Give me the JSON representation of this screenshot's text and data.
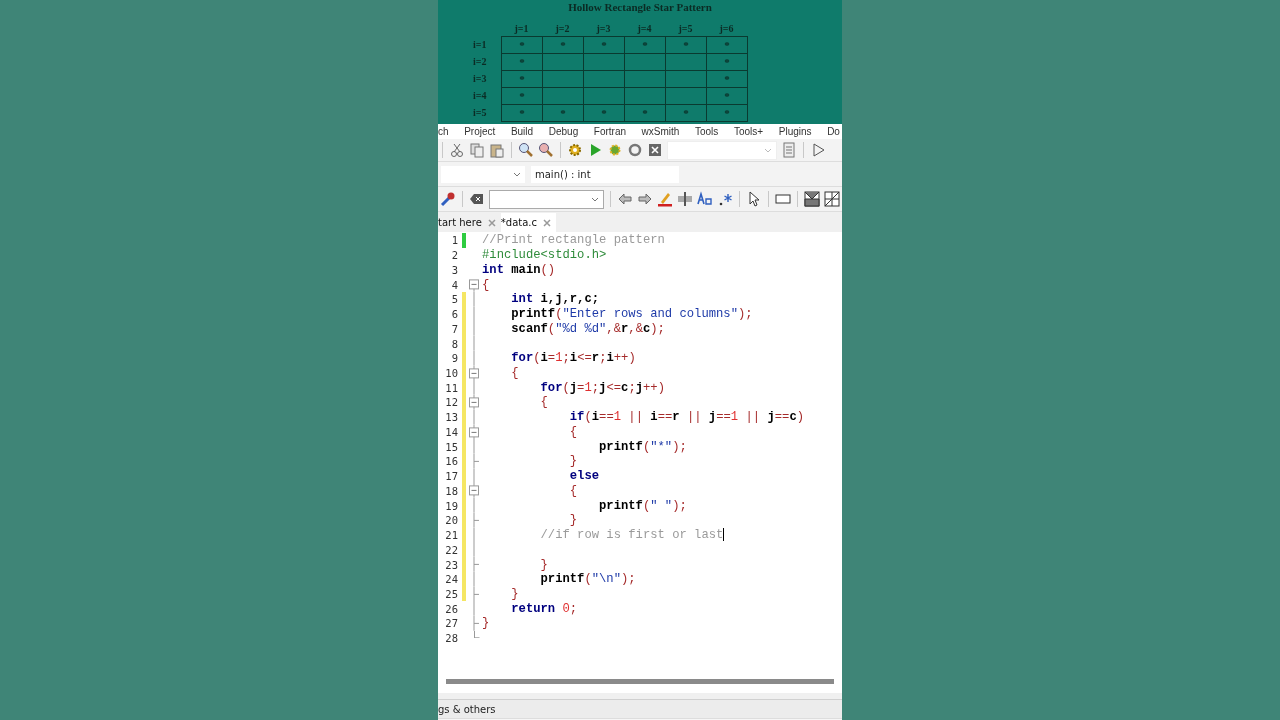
{
  "diagram": {
    "title": "Hollow Rectangle Star Pattern",
    "columns": [
      "j=1",
      "j=2",
      "j=3",
      "j=4",
      "j=5",
      "j=6"
    ],
    "rows": [
      {
        "label": "i=1",
        "cells": [
          "*",
          "*",
          "*",
          "*",
          "*",
          "*"
        ]
      },
      {
        "label": "i=2",
        "cells": [
          "*",
          null,
          null,
          null,
          null,
          "*"
        ]
      },
      {
        "label": "i=3",
        "cells": [
          "*",
          null,
          null,
          null,
          null,
          "*"
        ]
      },
      {
        "label": "i=4",
        "cells": [
          "*",
          null,
          null,
          null,
          null,
          "*"
        ]
      },
      {
        "label": "i=5",
        "cells": [
          "*",
          "*",
          "*",
          "*",
          "*",
          "*"
        ]
      }
    ]
  },
  "menu": [
    "ch",
    "Project",
    "Build",
    "Debug",
    "Fortran",
    "wxSmith",
    "Tools",
    "Tools+",
    "Plugins",
    "Do"
  ],
  "function_selector": {
    "value": "main() : int"
  },
  "tabs": [
    {
      "label": "tart here",
      "selected": false
    },
    {
      "label": "*data.c",
      "selected": true
    }
  ],
  "code_lines": [
    {
      "number": "1",
      "saved": true,
      "changed": false,
      "fold_start": false,
      "fold_end": false,
      "tokens": [
        {
          "kind": "comment",
          "text": "//Print rectangle pattern"
        }
      ]
    },
    {
      "number": "2",
      "saved": false,
      "changed": false,
      "fold_start": false,
      "fold_end": false,
      "tokens": [
        {
          "kind": "preprocessor",
          "text": "#include<stdio.h>"
        }
      ]
    },
    {
      "number": "3",
      "saved": false,
      "changed": false,
      "fold_start": false,
      "fold_end": false,
      "tokens": [
        {
          "kind": "keyword",
          "text": "int"
        },
        {
          "kind": "ident",
          "text": " main"
        },
        {
          "kind": "op",
          "text": "()"
        }
      ]
    },
    {
      "number": "4",
      "saved": false,
      "changed": false,
      "fold_start": true,
      "fold_end": false,
      "tokens": [
        {
          "kind": "op",
          "text": "{"
        }
      ]
    },
    {
      "number": "5",
      "saved": false,
      "changed": true,
      "fold_start": false,
      "fold_end": false,
      "tokens": [
        {
          "kind": "keyword",
          "text": "    int"
        },
        {
          "kind": "ident",
          "text": " i,j,r,c;"
        }
      ]
    },
    {
      "number": "6",
      "saved": false,
      "changed": true,
      "fold_start": false,
      "fold_end": false,
      "tokens": [
        {
          "kind": "ident",
          "text": "    printf"
        },
        {
          "kind": "op",
          "text": "("
        },
        {
          "kind": "string",
          "text": "\"Enter rows and columns\""
        },
        {
          "kind": "op",
          "text": ");"
        }
      ]
    },
    {
      "number": "7",
      "saved": false,
      "changed": true,
      "fold_start": false,
      "fold_end": false,
      "tokens": [
        {
          "kind": "ident",
          "text": "    scanf"
        },
        {
          "kind": "op",
          "text": "("
        },
        {
          "kind": "string",
          "text": "\"%d %d\""
        },
        {
          "kind": "op",
          "text": ",&"
        },
        {
          "kind": "ident",
          "text": "r"
        },
        {
          "kind": "op",
          "text": ",&"
        },
        {
          "kind": "ident",
          "text": "c"
        },
        {
          "kind": "op",
          "text": ");"
        }
      ]
    },
    {
      "number": "8",
      "saved": false,
      "changed": true,
      "fold_start": false,
      "fold_end": false
    },
    {
      "number": "9",
      "saved": false,
      "changed": true,
      "fold_start": false,
      "fold_end": false,
      "tokens": [
        {
          "kind": "keyword",
          "text": "    for"
        },
        {
          "kind": "op",
          "text": "("
        },
        {
          "kind": "ident",
          "text": "i"
        },
        {
          "kind": "op",
          "text": "="
        },
        {
          "kind": "number",
          "text": "1"
        },
        {
          "kind": "op",
          "text": ";"
        },
        {
          "kind": "ident",
          "text": "i"
        },
        {
          "kind": "op",
          "text": "<="
        },
        {
          "kind": "ident",
          "text": "r"
        },
        {
          "kind": "op",
          "text": ";"
        },
        {
          "kind": "ident",
          "text": "i"
        },
        {
          "kind": "op",
          "text": "++)"
        }
      ]
    },
    {
      "number": "10",
      "saved": false,
      "changed": true,
      "fold_start": true,
      "fold_end": false,
      "tokens": [
        {
          "kind": "op",
          "text": "    {"
        }
      ]
    },
    {
      "number": "11",
      "saved": false,
      "changed": true,
      "fold_start": false,
      "fold_end": false,
      "tokens": [
        {
          "kind": "keyword",
          "text": "        for"
        },
        {
          "kind": "op",
          "text": "("
        },
        {
          "kind": "ident",
          "text": "j"
        },
        {
          "kind": "op",
          "text": "="
        },
        {
          "kind": "number",
          "text": "1"
        },
        {
          "kind": "op",
          "text": ";"
        },
        {
          "kind": "ident",
          "text": "j"
        },
        {
          "kind": "op",
          "text": "<="
        },
        {
          "kind": "ident",
          "text": "c"
        },
        {
          "kind": "op",
          "text": ";"
        },
        {
          "kind": "ident",
          "text": "j"
        },
        {
          "kind": "op",
          "text": "++)"
        }
      ]
    },
    {
      "number": "12",
      "saved": false,
      "changed": true,
      "fold_start": true,
      "fold_end": false,
      "tokens": [
        {
          "kind": "op",
          "text": "        {"
        }
      ]
    },
    {
      "number": "13",
      "saved": false,
      "changed": true,
      "fold_start": false,
      "fold_end": false,
      "tokens": [
        {
          "kind": "keyword",
          "text": "            if"
        },
        {
          "kind": "op",
          "text": "("
        },
        {
          "kind": "ident",
          "text": "i"
        },
        {
          "kind": "op",
          "text": "=="
        },
        {
          "kind": "number",
          "text": "1"
        },
        {
          "kind": "op",
          "text": " || "
        },
        {
          "kind": "ident",
          "text": "i"
        },
        {
          "kind": "op",
          "text": "=="
        },
        {
          "kind": "ident",
          "text": "r"
        },
        {
          "kind": "op",
          "text": " || "
        },
        {
          "kind": "ident",
          "text": "j"
        },
        {
          "kind": "op",
          "text": "=="
        },
        {
          "kind": "number",
          "text": "1"
        },
        {
          "kind": "op",
          "text": " || "
        },
        {
          "kind": "ident",
          "text": "j"
        },
        {
          "kind": "op",
          "text": "=="
        },
        {
          "kind": "ident",
          "text": "c"
        },
        {
          "kind": "op",
          "text": ")"
        }
      ]
    },
    {
      "number": "14",
      "saved": false,
      "changed": true,
      "fold_start": true,
      "fold_end": false,
      "tokens": [
        {
          "kind": "op",
          "text": "            {"
        }
      ]
    },
    {
      "number": "15",
      "saved": false,
      "changed": true,
      "fold_start": false,
      "fold_end": false,
      "tokens": [
        {
          "kind": "ident",
          "text": "                printf"
        },
        {
          "kind": "op",
          "text": "("
        },
        {
          "kind": "string",
          "text": "\"*\""
        },
        {
          "kind": "op",
          "text": ");"
        }
      ]
    },
    {
      "number": "16",
      "saved": false,
      "changed": true,
      "fold_start": false,
      "fold_end": true,
      "tokens": [
        {
          "kind": "op",
          "text": "            }"
        }
      ]
    },
    {
      "number": "17",
      "saved": false,
      "changed": true,
      "fold_start": false,
      "fold_end": false,
      "tokens": [
        {
          "kind": "keyword",
          "text": "            else"
        }
      ]
    },
    {
      "number": "18",
      "saved": false,
      "changed": true,
      "fold_start": true,
      "fold_end": false,
      "tokens": [
        {
          "kind": "op",
          "text": "            {"
        }
      ]
    },
    {
      "number": "19",
      "saved": false,
      "changed": true,
      "fold_start": false,
      "fold_end": false,
      "tokens": [
        {
          "kind": "ident",
          "text": "                printf"
        },
        {
          "kind": "op",
          "text": "("
        },
        {
          "kind": "string",
          "text": "\" \""
        },
        {
          "kind": "op",
          "text": ");"
        }
      ]
    },
    {
      "number": "20",
      "saved": false,
      "changed": true,
      "fold_start": false,
      "fold_end": true,
      "tokens": [
        {
          "kind": "op",
          "text": "            }"
        }
      ]
    },
    {
      "number": "21",
      "saved": false,
      "changed": true,
      "fold_start": false,
      "fold_end": false,
      "tokens": [
        {
          "kind": "comment",
          "text": "        //if row is first or last"
        }
      ]
    },
    {
      "number": "22",
      "saved": false,
      "changed": true,
      "fold_start": false,
      "fold_end": false
    },
    {
      "number": "23",
      "saved": false,
      "changed": true,
      "fold_start": false,
      "fold_end": true,
      "tokens": [
        {
          "kind": "op",
          "text": "        }"
        }
      ]
    },
    {
      "number": "24",
      "saved": false,
      "changed": true,
      "fold_start": false,
      "fold_end": false,
      "tokens": [
        {
          "kind": "ident",
          "text": "        printf"
        },
        {
          "kind": "op",
          "text": "("
        },
        {
          "kind": "string",
          "text": "\"\\n\""
        },
        {
          "kind": "op",
          "text": ");"
        }
      ]
    },
    {
      "number": "25",
      "saved": false,
      "changed": true,
      "fold_start": false,
      "fold_end": true,
      "tokens": [
        {
          "kind": "op",
          "text": "    }"
        }
      ]
    },
    {
      "number": "26",
      "saved": false,
      "changed": false,
      "fold_start": false,
      "fold_end": false,
      "tokens": [
        {
          "kind": "keyword",
          "text": "    return"
        },
        {
          "kind": "number",
          "text": " 0"
        },
        {
          "kind": "op",
          "text": ";"
        }
      ]
    },
    {
      "number": "27",
      "saved": false,
      "changed": false,
      "fold_start": false,
      "fold_end": true,
      "tokens": [
        {
          "kind": "op",
          "text": "}"
        }
      ]
    },
    {
      "number": "28",
      "saved": false,
      "changed": false,
      "fold_start": false,
      "fold_end": true
    }
  ],
  "bottom_panel": {
    "title": "gs & others"
  }
}
